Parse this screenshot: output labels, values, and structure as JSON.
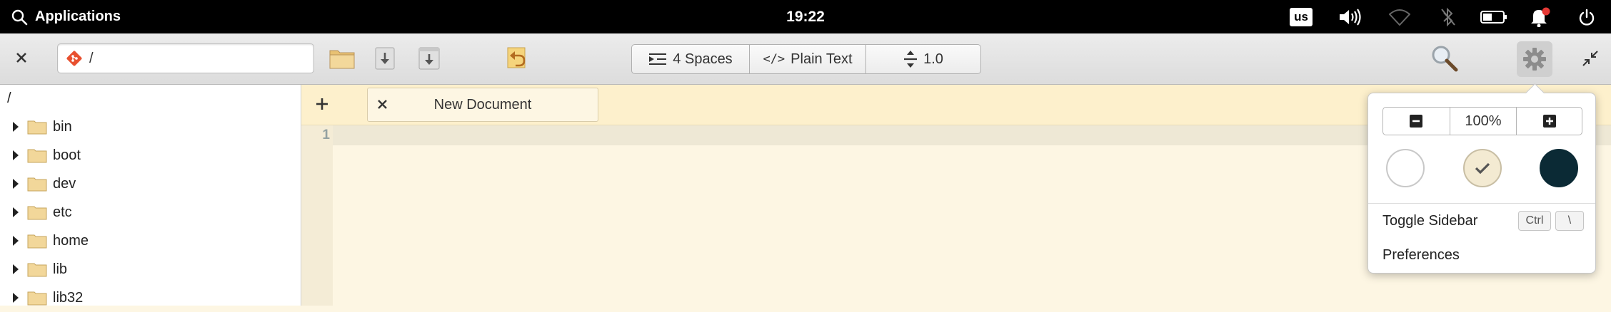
{
  "panel": {
    "applications_label": "Applications",
    "clock": "19:22",
    "keyboard_layout": "us"
  },
  "headerbar": {
    "path_value": "/",
    "indent_label": "4 Spaces",
    "language_label": "Plain Text",
    "line_spacing_label": "1.0"
  },
  "sidebar": {
    "root": "/",
    "items": [
      {
        "name": "bin"
      },
      {
        "name": "boot"
      },
      {
        "name": "dev"
      },
      {
        "name": "etc"
      },
      {
        "name": "home"
      },
      {
        "name": "lib"
      },
      {
        "name": "lib32"
      }
    ]
  },
  "editor": {
    "tab_title": "New Document",
    "line_numbers": [
      "1"
    ]
  },
  "menu": {
    "zoom_level": "100%",
    "themes": [
      {
        "name": "light",
        "color": "#ffffff",
        "selected": false
      },
      {
        "name": "solarized-light",
        "color": "#f3ead2",
        "selected": true
      },
      {
        "name": "dark",
        "color": "#0b2a35",
        "selected": false
      }
    ],
    "toggle_sidebar_label": "Toggle Sidebar",
    "toggle_sidebar_key1": "Ctrl",
    "toggle_sidebar_key2": "\\",
    "preferences_label": "Preferences"
  },
  "colors": {
    "editor_bg": "#fdf6e3",
    "tabbar_bg": "#fdf0cc",
    "folder": "#f2d79a",
    "notification_dot": "#e53935",
    "dark_theme": "#0b2a35"
  }
}
